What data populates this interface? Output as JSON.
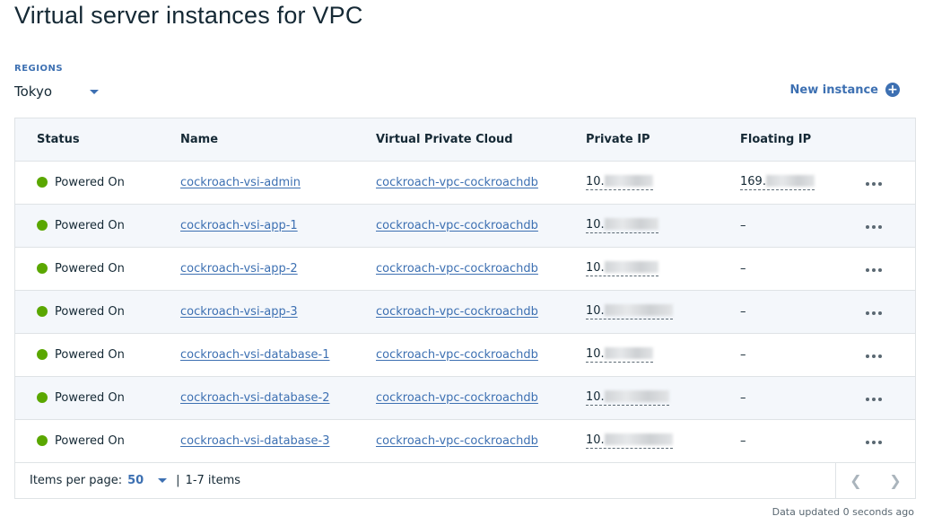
{
  "page": {
    "title": "Virtual server instances for VPC"
  },
  "regions": {
    "label": "REGIONS",
    "selected": "Tokyo"
  },
  "actions": {
    "new_instance_label": "New instance"
  },
  "table": {
    "columns": [
      "Status",
      "Name",
      "Virtual Private Cloud",
      "Private IP",
      "Floating IP"
    ],
    "rows": [
      {
        "status": "Powered On",
        "name": "cockroach-vsi-admin",
        "vpc": "cockroach-vpc-cockroachdb",
        "private_ip_prefix": "10.",
        "floating_ip": "169."
      },
      {
        "status": "Powered On",
        "name": "cockroach-vsi-app-1",
        "vpc": "cockroach-vpc-cockroachdb",
        "private_ip_prefix": "10.",
        "floating_ip": "–"
      },
      {
        "status": "Powered On",
        "name": "cockroach-vsi-app-2",
        "vpc": "cockroach-vpc-cockroachdb",
        "private_ip_prefix": "10.",
        "floating_ip": "–"
      },
      {
        "status": "Powered On",
        "name": "cockroach-vsi-app-3",
        "vpc": "cockroach-vpc-cockroachdb",
        "private_ip_prefix": "10.",
        "floating_ip": "–"
      },
      {
        "status": "Powered On",
        "name": "cockroach-vsi-database-1",
        "vpc": "cockroach-vpc-cockroachdb",
        "private_ip_prefix": "10.",
        "floating_ip": "–"
      },
      {
        "status": "Powered On",
        "name": "cockroach-vsi-database-2",
        "vpc": "cockroach-vpc-cockroachdb",
        "private_ip_prefix": "10.",
        "floating_ip": "–"
      },
      {
        "status": "Powered On",
        "name": "cockroach-vsi-database-3",
        "vpc": "cockroach-vpc-cockroachdb",
        "private_ip_prefix": "10.",
        "floating_ip": "–"
      }
    ]
  },
  "pagination": {
    "items_per_page_label": "Items per page:",
    "items_per_page_value": "50",
    "separator": "|",
    "range_text": "1-7 items",
    "prev_icon": "chevron-left-icon",
    "next_icon": "chevron-right-icon"
  },
  "footer": {
    "updated_text": "Data updated 0 seconds ago"
  },
  "colors": {
    "accent": "#3d70b2",
    "status_on": "#5aa700",
    "header_bg": "#f4f7fb",
    "border": "#dfe3e6"
  }
}
